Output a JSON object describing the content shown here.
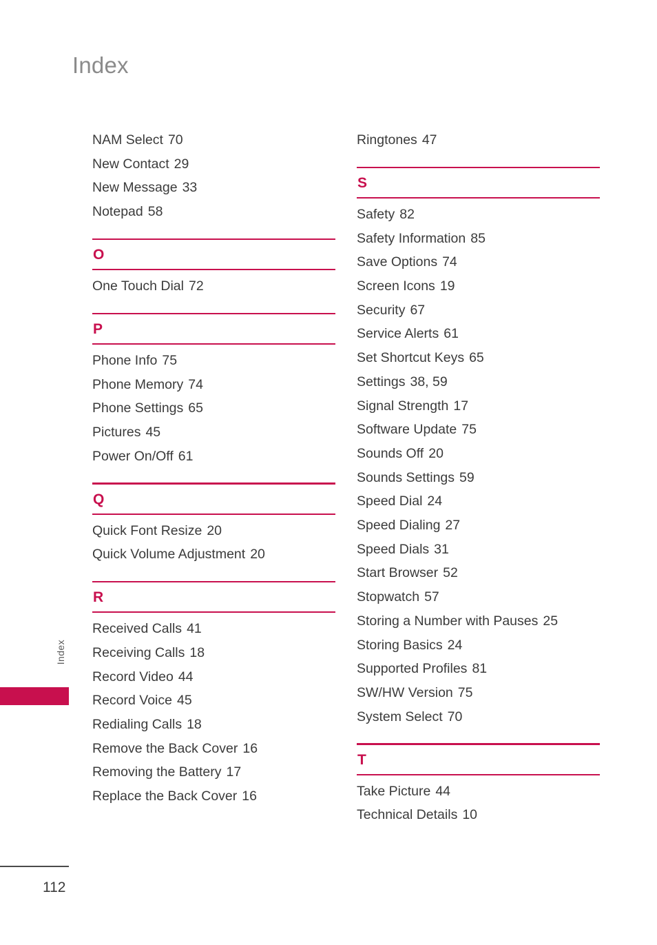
{
  "page": {
    "title": "Index",
    "folio": "112",
    "side_tab_label": "Index",
    "accent_color": "#c8104e",
    "title_color": "#8b8b8b",
    "text_color": "#3b3b3b"
  },
  "columns": [
    {
      "blocks": [
        {
          "type": "entries",
          "entries": [
            {
              "term": "NAM Select",
              "pages": "70"
            },
            {
              "term": "New Contact",
              "pages": "29"
            },
            {
              "term": "New Message",
              "pages": "33"
            },
            {
              "term": "Notepad",
              "pages": "58"
            }
          ]
        },
        {
          "type": "section",
          "letter": "O"
        },
        {
          "type": "entries",
          "entries": [
            {
              "term": "One Touch Dial",
              "pages": "72"
            }
          ]
        },
        {
          "type": "section",
          "letter": "P"
        },
        {
          "type": "entries",
          "entries": [
            {
              "term": "Phone Info",
              "pages": "75"
            },
            {
              "term": "Phone Memory",
              "pages": "74"
            },
            {
              "term": "Phone Settings",
              "pages": "65"
            },
            {
              "term": "Pictures",
              "pages": "45"
            },
            {
              "term": "Power On/Off",
              "pages": "61"
            }
          ]
        },
        {
          "type": "section",
          "letter": "Q"
        },
        {
          "type": "entries",
          "entries": [
            {
              "term": "Quick Font Resize",
              "pages": "20"
            },
            {
              "term": "Quick Volume Adjustment",
              "pages": "20"
            }
          ]
        },
        {
          "type": "section",
          "letter": "R"
        },
        {
          "type": "entries",
          "entries": [
            {
              "term": "Received Calls",
              "pages": "41"
            },
            {
              "term": "Receiving Calls",
              "pages": "18"
            },
            {
              "term": "Record Video",
              "pages": "44"
            },
            {
              "term": "Record Voice",
              "pages": "45"
            },
            {
              "term": "Redialing Calls",
              "pages": "18"
            },
            {
              "term": "Remove the Back Cover",
              "pages": "16"
            },
            {
              "term": "Removing the Battery",
              "pages": "17"
            },
            {
              "term": "Replace the Back Cover",
              "pages": "16"
            }
          ]
        }
      ]
    },
    {
      "blocks": [
        {
          "type": "entries",
          "entries": [
            {
              "term": "Ringtones",
              "pages": "47"
            }
          ]
        },
        {
          "type": "section",
          "letter": "S"
        },
        {
          "type": "entries",
          "entries": [
            {
              "term": "Safety",
              "pages": "82"
            },
            {
              "term": "Safety Information",
              "pages": "85"
            },
            {
              "term": "Save Options",
              "pages": "74"
            },
            {
              "term": "Screen Icons",
              "pages": "19"
            },
            {
              "term": "Security",
              "pages": "67"
            },
            {
              "term": "Service Alerts",
              "pages": "61"
            },
            {
              "term": "Set Shortcut Keys",
              "pages": "65"
            },
            {
              "term": "Settings",
              "pages": "38, 59"
            },
            {
              "term": "Signal Strength",
              "pages": "17"
            },
            {
              "term": "Software Update",
              "pages": "75"
            },
            {
              "term": "Sounds Off",
              "pages": "20"
            },
            {
              "term": "Sounds Settings",
              "pages": "59"
            },
            {
              "term": "Speed Dial",
              "pages": "24"
            },
            {
              "term": "Speed Dialing",
              "pages": "27"
            },
            {
              "term": "Speed Dials",
              "pages": "31"
            },
            {
              "term": "Start Browser",
              "pages": "52"
            },
            {
              "term": "Stopwatch",
              "pages": "57"
            },
            {
              "term": "Storing a Number with Pauses",
              "pages": "25"
            },
            {
              "term": "Storing Basics",
              "pages": "24"
            },
            {
              "term": "Supported Profiles",
              "pages": "81"
            },
            {
              "term": "SW/HW Version",
              "pages": "75"
            },
            {
              "term": "System Select",
              "pages": "70"
            }
          ]
        },
        {
          "type": "section",
          "letter": "T"
        },
        {
          "type": "entries",
          "entries": [
            {
              "term": "Take Picture",
              "pages": "44"
            },
            {
              "term": "Technical Details",
              "pages": "10"
            }
          ]
        }
      ]
    }
  ]
}
